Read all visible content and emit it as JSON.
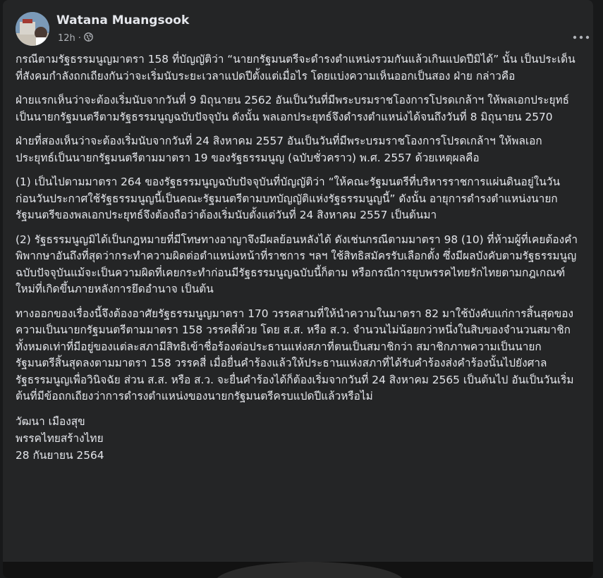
{
  "post": {
    "author": "Watana Muangsook",
    "time": "12h",
    "separator": "·",
    "privacy_icon": "globe-icon",
    "more_icon": "more-options-icon",
    "paragraphs": [
      "กรณีตามรัฐธรรมนูญมาตรา 158 ที่บัญญัติว่า “นายกรัฐมนตรีจะดำรงตำแหน่งรวมกันแล้วเกินแปดปีมิได้” นั้น เป็นประเด็นที่สังคมกำลังถกเถียงกันว่าจะเริ่มนับระยะเวลาแปดปีตั้งแต่เมื่อไร โดยแบ่งความเห็นออกเป็นสอง ฝ่าย กล่าวคือ",
      "ฝ่ายแรกเห็นว่าจะต้องเริ่มนับจากวันที่ 9 มิถุนายน 2562 อันเป็นวันที่มีพระบรมราชโองการโปรดเกล้าฯ ให้พลเอกประยุทธ์เป็นนายกรัฐมนตรีตามรัฐธรรมนูญฉบับปัจจุบัน ดังนั้น พลเอกประยุทธ์จึงดำรงตำแหน่งได้จนถึงวันที่ 8 มิถุนายน 2570",
      "ฝ่ายที่สองเห็นว่าจะต้องเริ่มนับจากวันที่ 24 สิงหาคม 2557 อันเป็นวันที่มีพระบรมราชโองการโปรดเกล้าฯ ให้พลเอกประยุทธ์เป็นนายกรัฐมนตรีตามมาตรา 19 ของรัฐธรรมนูญ (ฉบับชั่วคราว) พ.ศ. 2557 ด้วยเหตุผลคือ",
      "(1) เป็นไปตามมาตรา 264 ของรัฐธรรมนูญฉบับปัจจุบันที่บัญญัติว่า “ให้คณะรัฐมนตรีที่บริหารราชการแผ่นดินอยู่ในวันก่อนวันประกาศใช้รัฐธรรมนูญนี้เป็นคณะรัฐมนตรีตามบทบัญญัติแห่งรัฐธรรมนูญนี้” ดังนั้น อายุการดำรงตำแหน่งนายกรัฐมนตรีของพลเอกประยุทธ์จึงต้องถือว่าต้องเริ่มนับตั้งแต่วันที่ 24 สิงหาคม 2557 เป็นต้นมา",
      "(2) รัฐธรรมนูญมิได้เป็นกฎหมายที่มีโทษทางอาญาจึงมีผลย้อนหลังได้ ดังเช่นกรณีตามมาตรา 98 (10) ที่ห้ามผู้ที่เคยต้องคำพิพากษาอันถึงที่สุดว่ากระทำความผิดต่อตำแหน่งหน้าที่ราชการ ฯลฯ ใช้สิทธิสมัครรับเลือกตั้ง ซึ่งมีผลบังคับตามรัฐธรรมนูญฉบับปัจจุบันแม้จะเป็นความผิดที่เคยกระทำก่อนมีรัฐธรรมนูญฉบับนี้ก็ตาม หรือกรณีการยุบพรรคไทยรักไทยตามกฎเกณฑ์ใหม่ที่เกิดขึ้นภายหลังการยึดอำนาจ เป็นต้น",
      "ทางออกของเรื่องนี้จึงต้องอาศัยรัฐธรรมนูญมาตรา 170 วรรคสามที่ให้นำความในมาตรา 82 มาใช้บังคับแก่การสิ้นสุดของความเป็นนายกรัฐมนตรีตามมาตรา 158 วรรคสี่ด้วย โดย ส.ส. หรือ ส.ว. จำนวนไม่น้อยกว่าหนึ่งในสิบของจำนวนสมาชิกทั้งหมดเท่าที่มีอยู่ของแต่ละสภามีสิทธิเข้าชื่อร้องต่อประธานแห่งสภาที่ตนเป็นสมาชิกว่า สมาชิกภาพความเป็นนายกรัฐมนตรีสิ้นสุดลงตามมาตรา 158 วรรคสี่ เมื่อยื่นคำร้องแล้วให้ประธานแห่งสภาที่ได้รับคำร้องส่งคำร้องนั้นไปยังศาลรัฐธรรมนูญเพื่อวินิจฉัย ส่วน ส.ส. หรือ ส.ว. จะยื่นคำร้องได้ก็ต้องเริ่มจากวันที่ 24 สิงหาคม 2565 เป็นต้นไป อันเป็นวันเริ่มต้นที่มีข้อถกเถียงว่าการดำรงตำแหน่งของนายกรัฐมนตรีครบแปดปีแล้วหรือไม่"
    ],
    "signature": {
      "name": "วัฒนา เมืองสุข",
      "party": "พรรคไทยสร้างไทย",
      "date": "28 กันยายน 2564"
    }
  }
}
